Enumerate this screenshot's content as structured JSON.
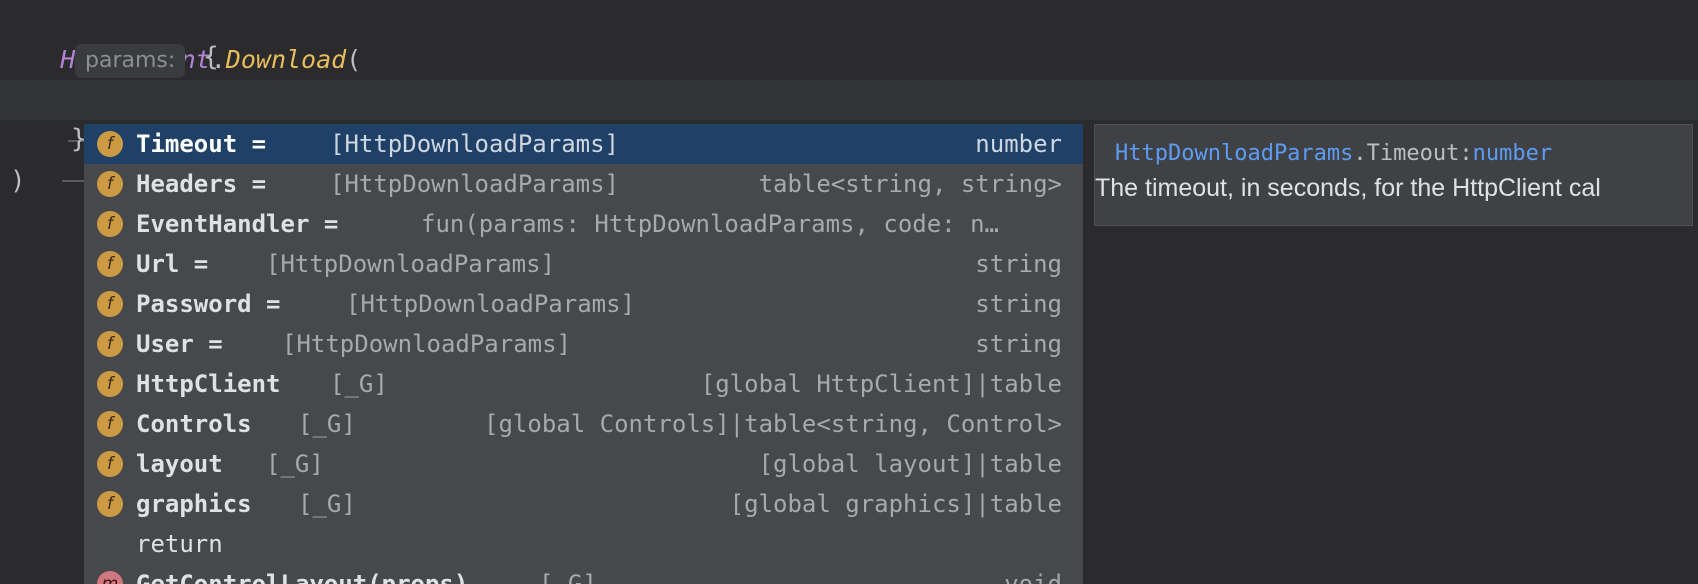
{
  "editor": {
    "line1": {
      "class_name": "HttpClient",
      "dot": ".",
      "method": "Download",
      "paren": "("
    },
    "param_hint": "params:",
    "open_brace": "{",
    "close_brace": "}",
    "close_paren": ")"
  },
  "completion": {
    "items": [
      {
        "icon": "f",
        "icon_name": "field-icon",
        "name": "Timeout =",
        "tail": "[HttpDownloadParams]",
        "type": "number",
        "selected": true
      },
      {
        "icon": "f",
        "icon_name": "field-icon",
        "name": "Headers =",
        "tail": "[HttpDownloadParams]",
        "type": "table<string, string>"
      },
      {
        "icon": "f",
        "icon_name": "field-icon",
        "name": "EventHandler =",
        "tail": "fun(params: HttpDownloadParams, code: n…",
        "type": ""
      },
      {
        "icon": "f",
        "icon_name": "field-icon",
        "name": "Url =",
        "tail": "[HttpDownloadParams]",
        "type": "string"
      },
      {
        "icon": "f",
        "icon_name": "field-icon",
        "name": "Password =",
        "tail": "[HttpDownloadParams]",
        "type": "string"
      },
      {
        "icon": "f",
        "icon_name": "field-icon",
        "name": "User =",
        "tail": "[HttpDownloadParams]",
        "type": "string"
      },
      {
        "icon": "f",
        "icon_name": "field-icon",
        "name": "HttpClient",
        "tail": "[_G]",
        "type": "[global HttpClient]|table"
      },
      {
        "icon": "f",
        "icon_name": "field-icon",
        "name": "Controls",
        "tail": "[_G]",
        "type": "[global Controls]|table<string, Control>"
      },
      {
        "icon": "f",
        "icon_name": "field-icon",
        "name": "layout",
        "tail": "[_G]",
        "type": "[global layout]|table"
      },
      {
        "icon": "f",
        "icon_name": "field-icon",
        "name": "graphics",
        "tail": "[_G]",
        "type": "[global graphics]|table"
      },
      {
        "icon": "",
        "icon_name": "",
        "name": "return",
        "tail": "",
        "type": ""
      },
      {
        "icon": "m",
        "icon_name": "method-icon",
        "name": "GetControlLayout(props)",
        "tail": "[_G]",
        "type": "void"
      }
    ]
  },
  "doc_popup": {
    "owner": "HttpDownloadParams",
    "member": ".Timeout:",
    "type": "number",
    "description": "The timeout, in seconds, for the HttpClient cal"
  },
  "colors": {
    "background": "#2b2b2d",
    "popup_bg": "#46484b",
    "selected_row": "#1f4167",
    "field_badge": "#cc9a43",
    "method_badge": "#d0787e",
    "link_blue": "#5c9cf5",
    "class_purple": "#b383d6",
    "function_yellow": "#e8bd5c"
  }
}
